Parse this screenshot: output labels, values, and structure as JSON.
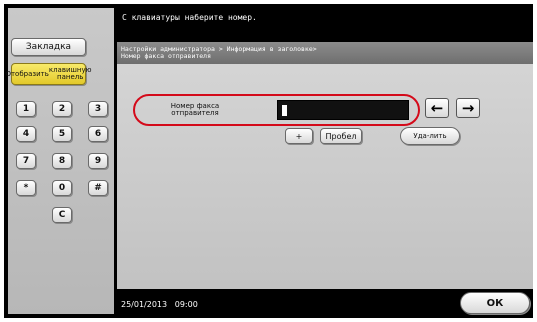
{
  "left_panel": {
    "bookmark_label": "Закладка",
    "show_keypad_line1": "Отобразить",
    "show_keypad_line2": "клавишную панель",
    "keys": [
      "1",
      "2",
      "3",
      "4",
      "5",
      "6",
      "7",
      "8",
      "9",
      "*",
      "0",
      "#",
      "C"
    ]
  },
  "message": "С клавиатуры наберите номер.",
  "breadcrumb": {
    "line1": "Настройки администратора > Информация в заголовке>",
    "line2": "Номер факса отправителя"
  },
  "field": {
    "label_line1": "Номер факса",
    "label_line2": "отправителя",
    "value": ""
  },
  "buttons": {
    "arrow_left": "←",
    "arrow_right": "→",
    "plus": "+",
    "space": "Пробел",
    "delete_line1": "Уда-",
    "delete_line2": "лить",
    "ok": "ОК"
  },
  "footer": {
    "date": "25/01/2013",
    "time": "09:00"
  },
  "colors": {
    "highlight": "#d40a1a",
    "keypad_button": "#e8d040"
  }
}
